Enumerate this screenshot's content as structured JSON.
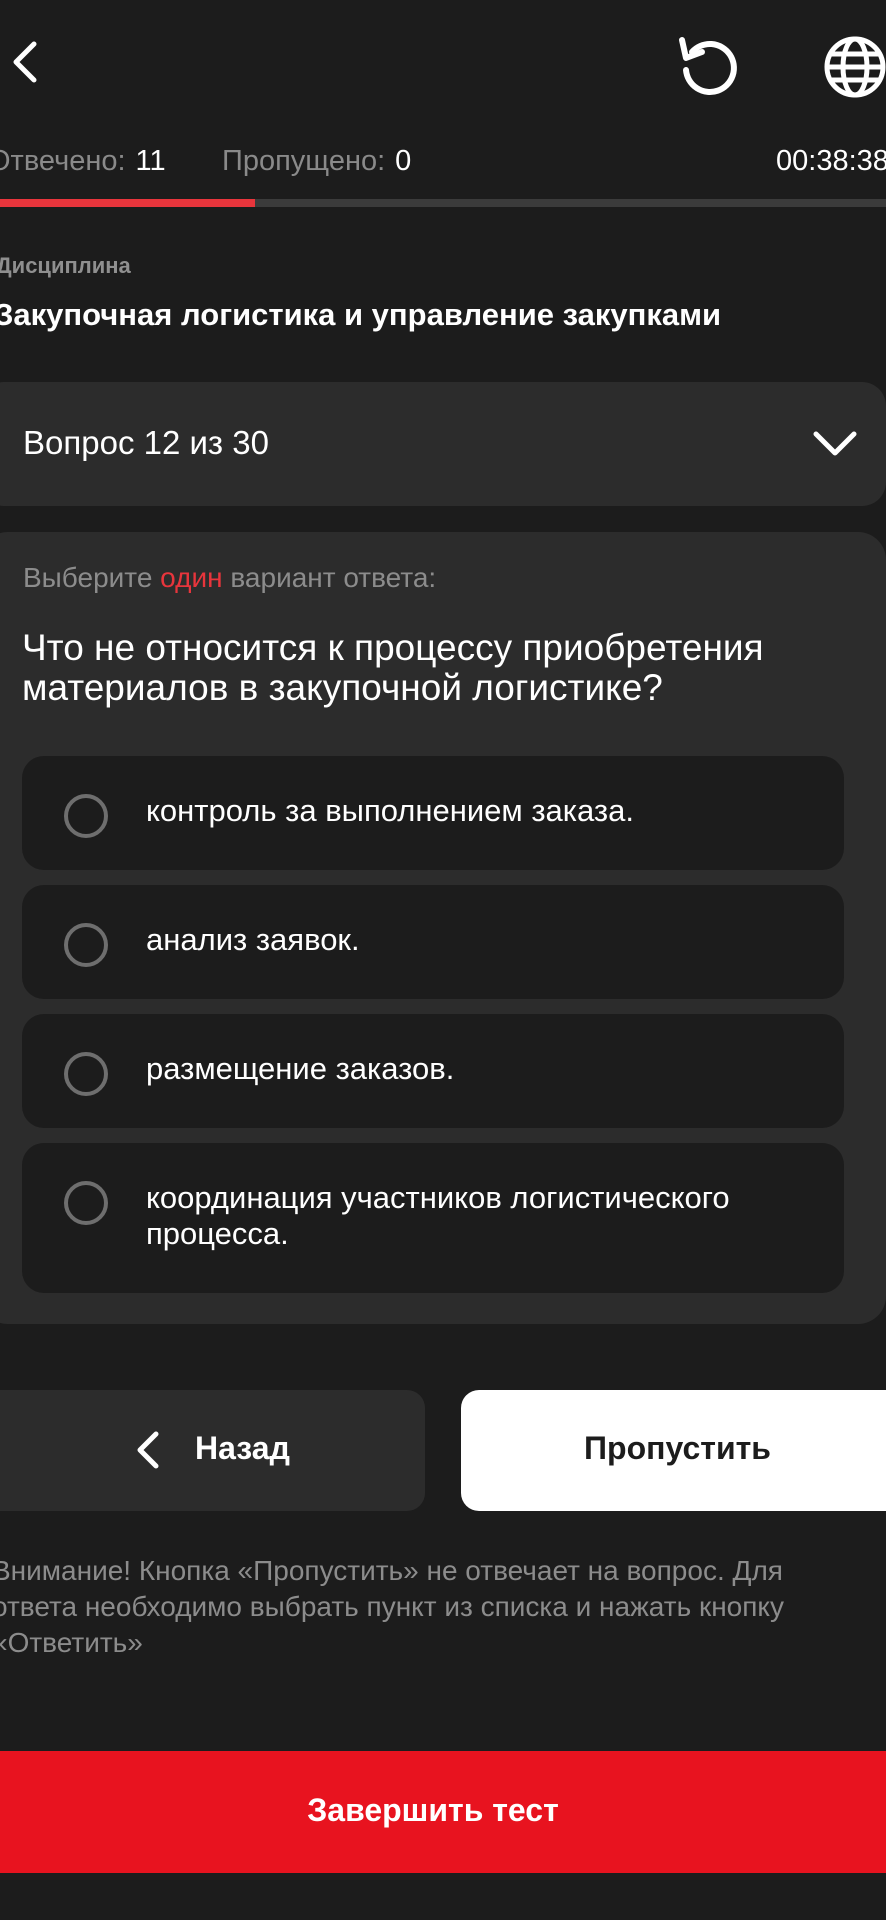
{
  "header": {
    "answered_label": "Отвечено:",
    "answered_value": "11",
    "skipped_label": "Пропущено:",
    "skipped_value": "0",
    "timer": "00:38:38",
    "progress_fraction": 0.2876,
    "icons": [
      "chevron-left-icon",
      "reset-icon",
      "globe-icon"
    ]
  },
  "discipline": {
    "label": "Дисциплина",
    "name": "Закупочная логистика и управление закупками"
  },
  "question_selector": {
    "label": "Вопрос 12 из 30"
  },
  "question": {
    "instruction_prefix": "Выберите",
    "instruction_accent": "один",
    "instruction_suffix": "вариант ответа:",
    "text": "Что не относится к процессу приобретения материалов в закупочной логистике?",
    "options": [
      {
        "label": "контроль за выполнением заказа."
      },
      {
        "label": "анализ заявок."
      },
      {
        "label": "размещение заказов."
      },
      {
        "label": "координация участников логистического процесса."
      }
    ]
  },
  "actions": {
    "back_label": "Назад",
    "skip_label": "Пропустить",
    "finish_label": "Завершить тест"
  },
  "notice": "Внимание! Кнопка «Пропустить» не отвечает на вопрос. Для ответа необходимо выбрать пункт из списка и нажать кнопку «Ответить»",
  "colors": {
    "background": "#1c1c1c",
    "surface": "#2c2c2c",
    "accent": "#e8353c",
    "finish_button": "#e8131f"
  }
}
